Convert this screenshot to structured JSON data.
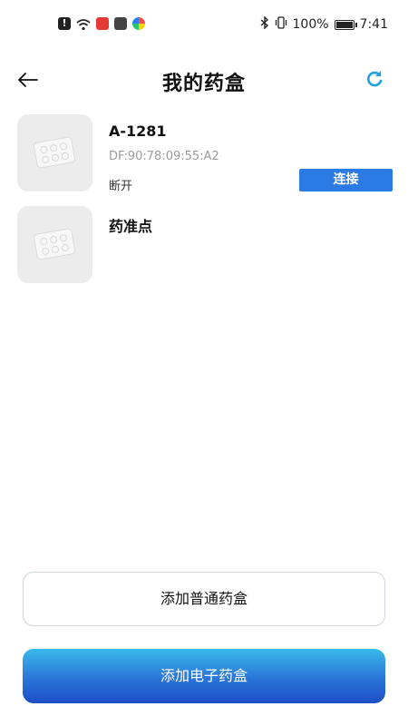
{
  "status_bar": {
    "battery_pct": "100%",
    "time": "7:41",
    "icons": [
      "alert-icon",
      "wifi-icon",
      "red-app-icon",
      "mail-icon",
      "color-app-icon",
      "bluetooth-icon",
      "vibrate-icon",
      "battery-icon"
    ]
  },
  "header": {
    "title": "我的药盒",
    "back_icon": "arrow-left-icon",
    "refresh_icon": "refresh-icon"
  },
  "devices": [
    {
      "name": "A-1281",
      "mac": "DF:90:78:09:55:A2",
      "status": "断开",
      "action_label": "连接"
    },
    {
      "name": "药准点"
    }
  ],
  "actions": {
    "add_normal_label": "添加普通药盒",
    "add_electronic_label": "添加电子药盒"
  },
  "colors": {
    "accent": "#2c7be5",
    "refresh": "#1da1e0",
    "gradient_top": "#38b9ea",
    "gradient_bottom": "#1f4ec7"
  }
}
